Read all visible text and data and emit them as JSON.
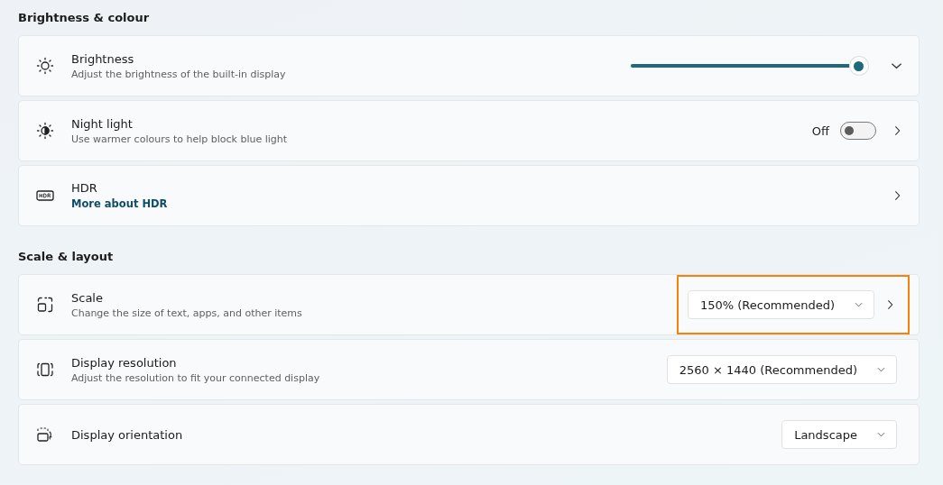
{
  "sections": [
    {
      "title": "Brightness & colour",
      "rows": [
        {
          "kind": "slider",
          "title": "Brightness",
          "subtitle": "Adjust the brightness of the built-in display",
          "level": 0.98,
          "expandable": true
        },
        {
          "kind": "toggle",
          "title": "Night light",
          "subtitle": "Use warmer colours to help block blue light",
          "on": false,
          "state_label": "Off",
          "has_details": true
        },
        {
          "kind": "link",
          "title": "HDR",
          "link": "More about HDR",
          "has_details": true
        }
      ]
    },
    {
      "title": "Scale & layout",
      "rows": [
        {
          "kind": "dropdown",
          "title": "Scale",
          "subtitle": "Change the size of text, apps, and other items",
          "value": "150% (Recommended)",
          "has_details": true,
          "highlighted": true
        },
        {
          "kind": "dropdown",
          "title": "Display resolution",
          "subtitle": "Adjust the resolution to fit your connected display",
          "value": "2560 × 1440 (Recommended)",
          "has_details": false,
          "highlighted": false
        },
        {
          "kind": "dropdown",
          "title": "Display orientation",
          "value": "Landscape",
          "has_details": false,
          "highlighted": false
        }
      ]
    }
  ]
}
